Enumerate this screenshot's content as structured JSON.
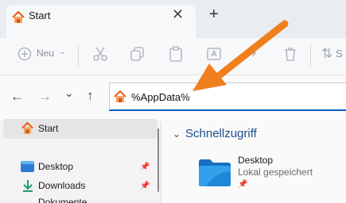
{
  "tab": {
    "title": "Start",
    "close": "✕",
    "new": "+"
  },
  "toolbar": {
    "new_label": "Neu",
    "new_chevron": "⌄",
    "sort_icon": "⇅",
    "sort_label": "S"
  },
  "nav": {
    "back": "←",
    "forward": "→",
    "recent": "⌄",
    "up": "↑"
  },
  "address": {
    "value": "%AppData%"
  },
  "sidebar": {
    "home_label": "Start",
    "items": [
      {
        "label": "Desktop"
      },
      {
        "label": "Downloads"
      },
      {
        "label": "Dokumente"
      }
    ]
  },
  "content": {
    "section_chevron": "⌄",
    "section_title": "Schnellzugriff",
    "items": [
      {
        "name": "Desktop",
        "subtitle": "Lokal gespeichert"
      }
    ]
  },
  "colors": {
    "accent": "#005fb8",
    "annotation_arrow": "#f0801e",
    "folder": "#1e88d6",
    "home_roof": "#e8590c"
  }
}
